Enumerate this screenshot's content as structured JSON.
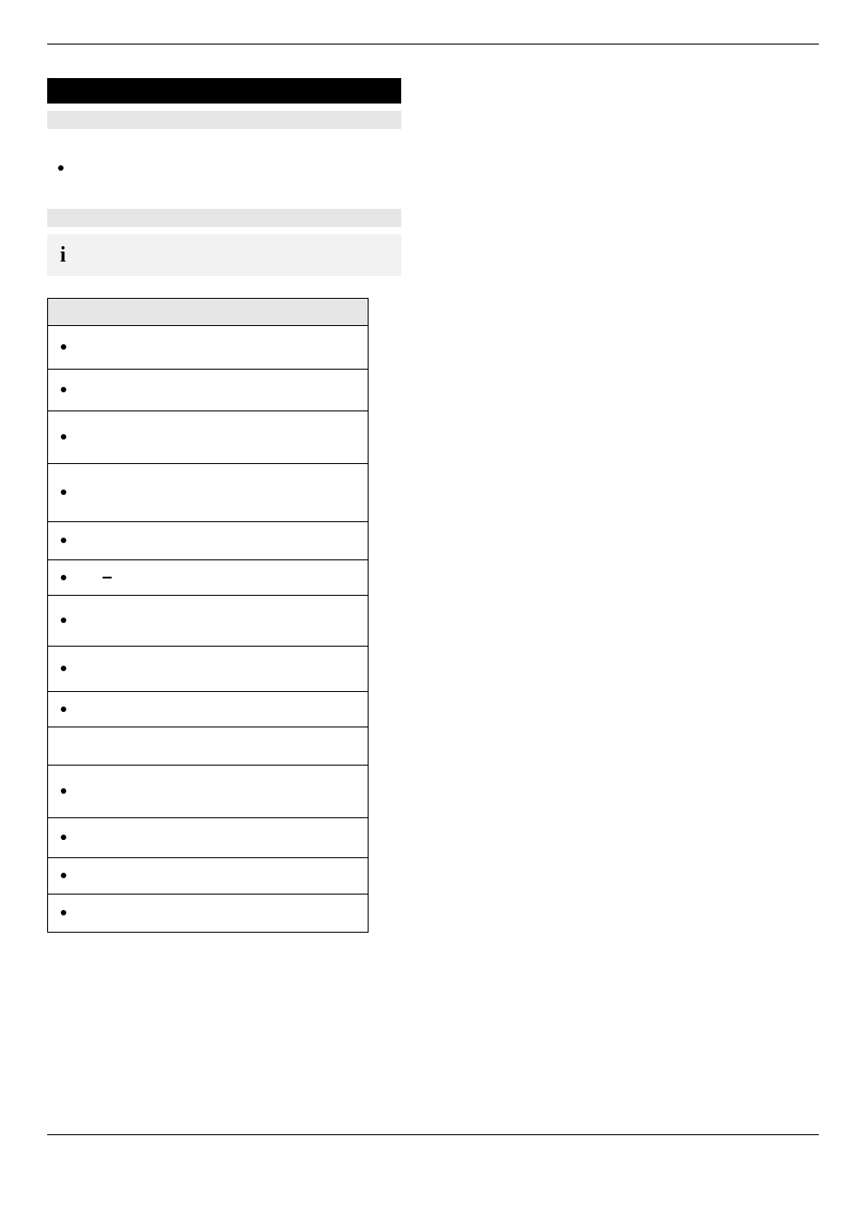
{
  "info_symbol": "i",
  "bullets": {
    "intro": ""
  },
  "table": {
    "header": "",
    "rows": [
      {
        "bullet": true,
        "dash": false
      },
      {
        "bullet": true,
        "dash": false
      },
      {
        "bullet": true,
        "dash": false
      },
      {
        "bullet": true,
        "dash": false
      },
      {
        "bullet": true,
        "dash": false
      },
      {
        "bullet": true,
        "dash": true
      },
      {
        "bullet": true,
        "dash": false
      },
      {
        "bullet": true,
        "dash": false
      },
      {
        "bullet": true,
        "dash": false
      },
      {
        "bullet": false,
        "dash": false
      },
      {
        "bullet": true,
        "dash": false
      },
      {
        "bullet": true,
        "dash": false
      },
      {
        "bullet": true,
        "dash": false
      },
      {
        "bullet": true,
        "dash": false
      }
    ]
  }
}
